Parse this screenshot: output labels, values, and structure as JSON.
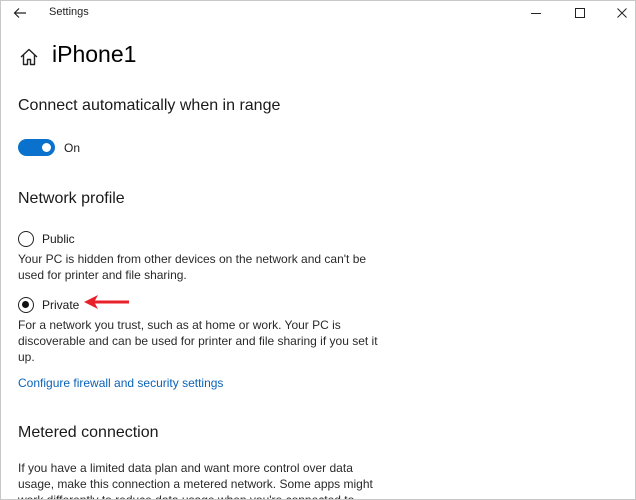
{
  "window": {
    "title": "Settings",
    "icons": {
      "back": "back-arrow-icon",
      "minimize": "minimize-icon",
      "maximize": "maximize-icon",
      "close": "close-icon"
    }
  },
  "page": {
    "home_icon": "home-icon",
    "title": "iPhone1"
  },
  "auto_connect": {
    "heading": "Connect automatically when in range",
    "toggle_state": "On",
    "toggle_on": true
  },
  "network_profile": {
    "heading": "Network profile",
    "options": [
      {
        "label": "Public",
        "selected": false,
        "description": "Your PC is hidden from other devices on the network and can't be used for printer and file sharing."
      },
      {
        "label": "Private",
        "selected": true,
        "description": "For a network you trust, such as at home or work. Your PC is discoverable and can be used for printer and file sharing if you set it up."
      }
    ],
    "firewall_link": "Configure firewall and security settings"
  },
  "metered": {
    "heading": "Metered connection",
    "description": "If you have a limited data plan and want more control over data usage, make this connection a metered network. Some apps might work differently to reduce data usage when you're connected to"
  },
  "annotation": {
    "arrow_color": "#e8202a"
  },
  "colors": {
    "accent": "#0a72cc",
    "link": "#0a63b8"
  }
}
